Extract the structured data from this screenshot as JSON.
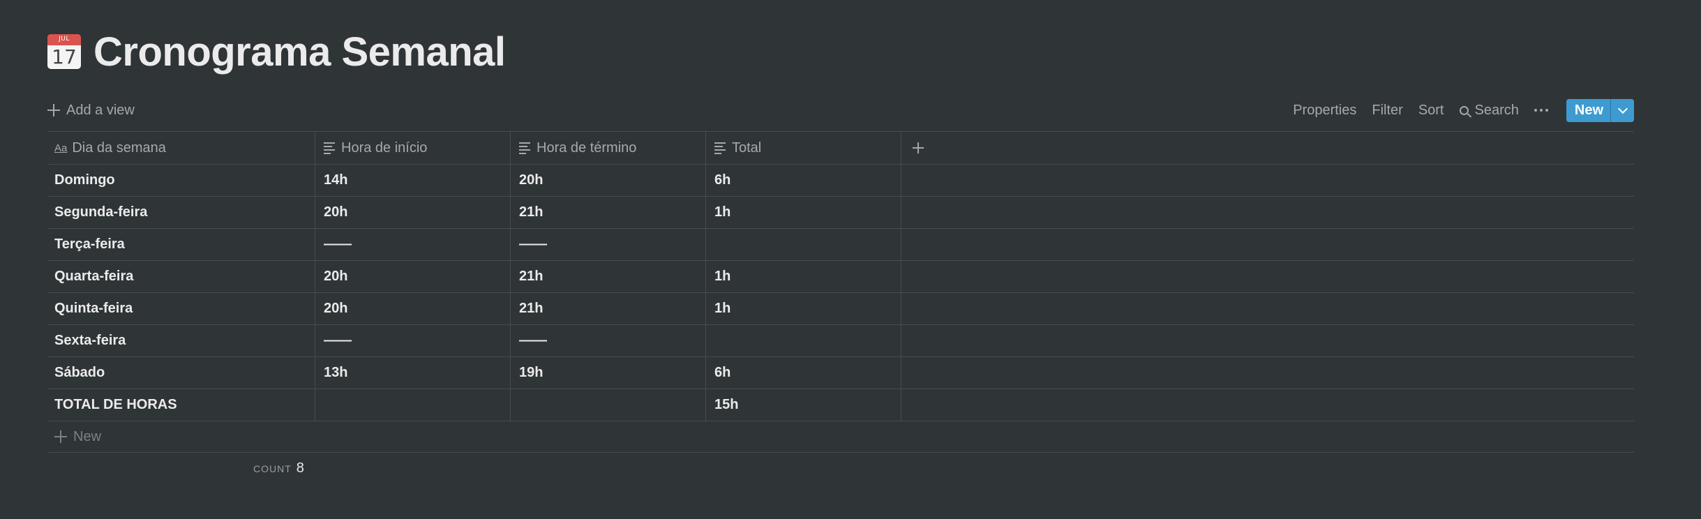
{
  "page": {
    "title": "Cronograma Semanal",
    "icon": "calendar-icon",
    "icon_month": "JUL",
    "icon_day": "17"
  },
  "toolbar": {
    "add_view_label": "Add a view",
    "properties_label": "Properties",
    "filter_label": "Filter",
    "sort_label": "Sort",
    "search_label": "Search",
    "new_label": "New",
    "accent_color": "#3d9bd1"
  },
  "table": {
    "columns": [
      {
        "label": "Dia da semana",
        "icon": "title-aa-icon"
      },
      {
        "label": "Hora de início",
        "icon": "text-property-icon"
      },
      {
        "label": "Hora de término",
        "icon": "text-property-icon"
      },
      {
        "label": "Total",
        "icon": "text-property-icon"
      }
    ],
    "rows": [
      {
        "day": "Domingo",
        "start": "14h",
        "end": "20h",
        "total": "6h"
      },
      {
        "day": "Segunda-feira",
        "start": "20h",
        "end": "21h",
        "total": "1h"
      },
      {
        "day": "Terça-feira",
        "start": "——",
        "end": "——",
        "total": ""
      },
      {
        "day": "Quarta-feira",
        "start": "20h",
        "end": "21h",
        "total": "1h"
      },
      {
        "day": "Quinta-feira",
        "start": "20h",
        "end": "21h",
        "total": "1h"
      },
      {
        "day": "Sexta-feira",
        "start": "——",
        "end": "——",
        "total": ""
      },
      {
        "day": "Sábado",
        "start": "13h",
        "end": "19h",
        "total": "6h"
      },
      {
        "day": "TOTAL DE HORAS",
        "start": "",
        "end": "",
        "total": "15h"
      }
    ],
    "new_row_label": "New",
    "count_label": "COUNT",
    "count_value": "8"
  }
}
